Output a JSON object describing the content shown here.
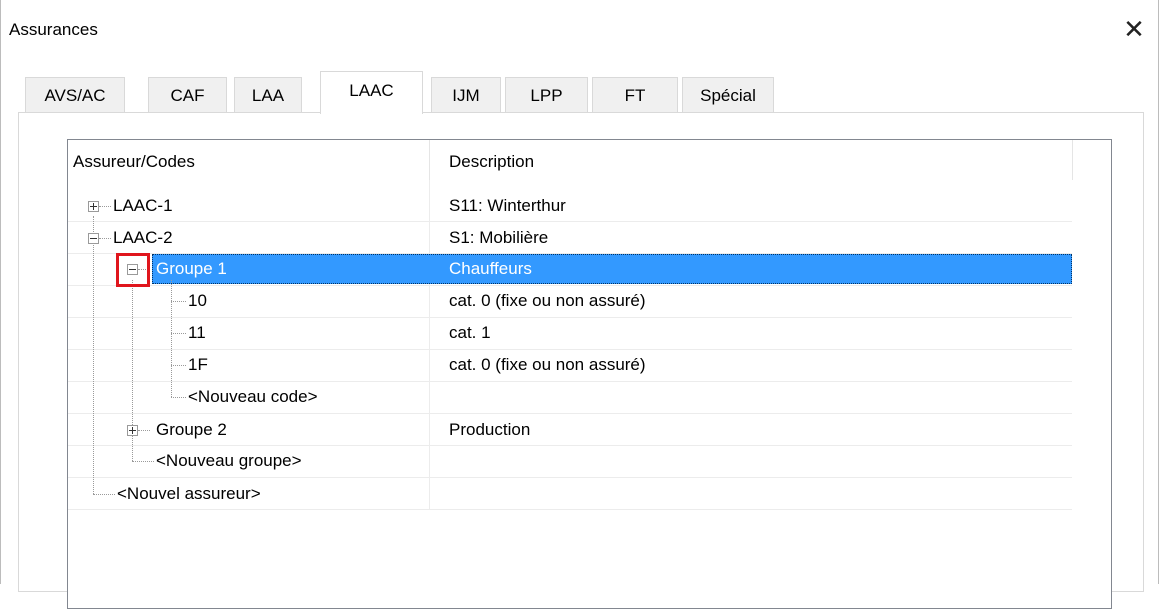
{
  "window": {
    "title": "Assurances",
    "close_glyph": "✕"
  },
  "tabs": [
    {
      "label": "AVS/AC",
      "active": false
    },
    {
      "label": "CAF",
      "active": false
    },
    {
      "label": "LAA",
      "active": false
    },
    {
      "label": "LAAC",
      "active": true
    },
    {
      "label": "IJM",
      "active": false
    },
    {
      "label": "LPP",
      "active": false
    },
    {
      "label": "FT",
      "active": false
    },
    {
      "label": "Spécial",
      "active": false
    }
  ],
  "tree": {
    "headers": {
      "col1": "Assureur/Codes",
      "col2": "Description"
    },
    "rows": [
      {
        "label": "LAAC-1",
        "description": "S11: Winterthur",
        "expander": "plus"
      },
      {
        "label": "LAAC-2",
        "description": "S1: Mobilière",
        "expander": "minus"
      },
      {
        "label": "Groupe 1",
        "description": "Chauffeurs",
        "expander": "minus",
        "selected": true
      },
      {
        "label": "10",
        "description": "cat. 0 (fixe ou non assuré)"
      },
      {
        "label": "11",
        "description": "cat. 1"
      },
      {
        "label": "1F",
        "description": "cat. 0 (fixe ou non assuré)"
      },
      {
        "label": "<Nouveau code>",
        "description": ""
      },
      {
        "label": "Groupe 2",
        "description": "Production",
        "expander": "plus"
      },
      {
        "label": "<Nouveau groupe>",
        "description": ""
      },
      {
        "label": "<Nouvel assureur>",
        "description": ""
      }
    ]
  },
  "colors": {
    "selection": "#3399ff",
    "highlight_box": "#e0161d"
  }
}
